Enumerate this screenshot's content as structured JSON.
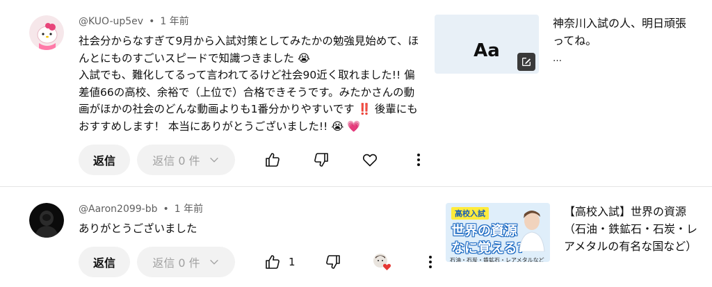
{
  "comments": [
    {
      "author": "@KUO-up5ev",
      "time": "1 年前",
      "lines": [
        "社会分からなすぎて9月から入試対策としてみたかの勉強見始めて、ほ",
        "んとにものすごいスピードで知識つきました 😭",
        "入試でも、難化してるって言われてるけど社会90近く取れました!! 偏",
        "差値66の高校、余裕で（上位で）合格できそうです。みたかさんの動",
        "画がほかの社会のどんな動画よりも1番分かりやすいです ‼️ 後輩にも",
        "おすすめします！ 本当にありがとうございました!! 😭 💗"
      ],
      "reply_label": "返信",
      "replies_label": "返信 0 件",
      "side": {
        "card_text": "Aa",
        "title_lines": [
          "神奈川入試の人、明日頑張",
          "ってね。"
        ],
        "more": "…"
      }
    },
    {
      "author": "@Aaron2099-bb",
      "time": "1 年前",
      "lines": [
        "ありがとうございました"
      ],
      "reply_label": "返信",
      "replies_label": "返信 0 件",
      "like_count": "1",
      "side": {
        "thumb_tag": "高校入試",
        "thumb_line1": "世界の資源",
        "thumb_line2": "なに覚える?",
        "thumb_caption": "石油・石炭・鉄鉱石・レアメタルなど",
        "title_lines": [
          "【高校入試】世界の資源",
          "（石油・鉄鉱石・石炭・レ",
          "アメタルの有名な国など）"
        ]
      }
    }
  ],
  "icons": {
    "like": "thumbs-up-icon",
    "dislike": "thumbs-down-icon",
    "heart": "heart-icon",
    "more": "more-vert-icon",
    "chevron": "chevron-down-icon",
    "edit": "edit-note-icon"
  },
  "colors": {
    "meta_gray": "#606060",
    "button_bg": "#f2f2f2",
    "heart_red": "#e53935"
  }
}
